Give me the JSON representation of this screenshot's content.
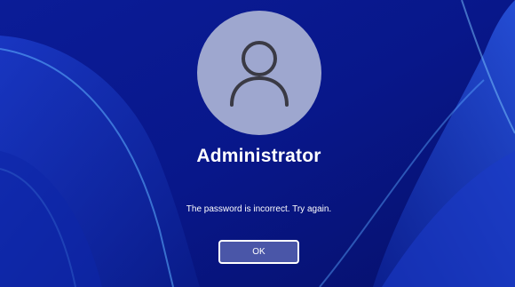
{
  "colors": {
    "background": "#0a1a8a",
    "avatar_circle": "#9ea7cf",
    "avatar_glyph": "#3a3a44",
    "button_fill": "#4a56a8",
    "text": "#ffffff"
  },
  "account": {
    "avatar_icon": "user-avatar-icon",
    "username": "Administrator"
  },
  "error": {
    "message": "The password is incorrect. Try again."
  },
  "actions": {
    "ok_label": "OK"
  }
}
